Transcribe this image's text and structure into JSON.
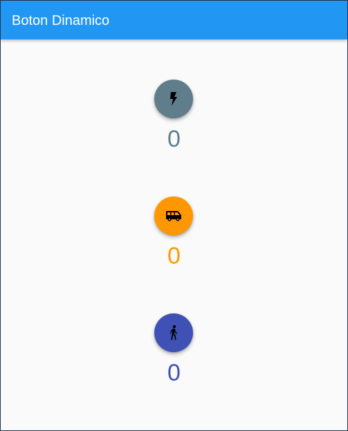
{
  "appbar": {
    "title": "Boton Dinamico",
    "color": "#2196f3"
  },
  "counters": [
    {
      "icon": "flash-icon",
      "color": "#607d8b",
      "value": "0"
    },
    {
      "icon": "van-icon",
      "color": "#ff9800",
      "value": "0"
    },
    {
      "icon": "walk-icon",
      "color": "#3f51b5",
      "value": "0"
    }
  ]
}
